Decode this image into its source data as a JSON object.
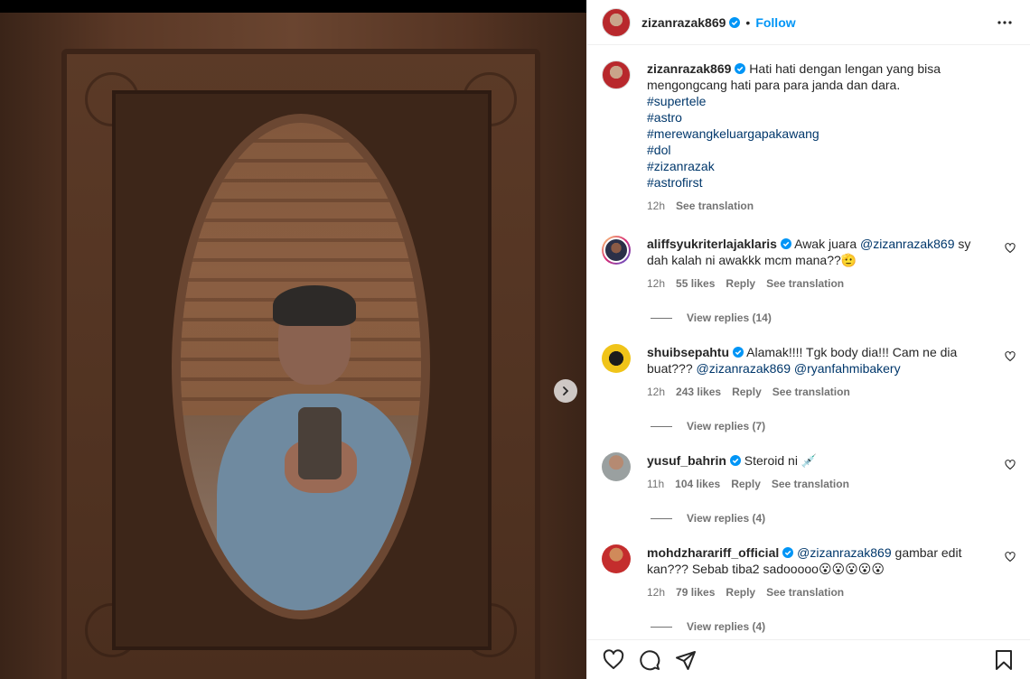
{
  "post": {
    "username": "zizanrazak869",
    "follow_label": "Follow",
    "separator": "•"
  },
  "caption": {
    "username": "zizanrazak869",
    "text": "Hati hati dengan lengan yang bisa mengongcang hati para para janda dan dara.",
    "hashtags": [
      "#supertele",
      "#astro",
      "#merewangkeluargapakawang",
      "#dol",
      "#zizanrazak",
      "#astrofirst"
    ],
    "time": "12h",
    "see_translation": "See translation"
  },
  "comments": [
    {
      "username": "aliffsyukriterlajaklaris",
      "text_before": "Awak juara ",
      "mention": "@zizanrazak869",
      "text_after": " sy dah kalah ni awakkk mcm mana??🫡",
      "time": "12h",
      "likes": "55 likes",
      "reply": "Reply",
      "see_translation": "See translation",
      "view_replies": "View replies (14)"
    },
    {
      "username": "shuibsepahtu",
      "text_before": "Alamak!!!! Tgk body dia!!! Cam ne dia buat??? ",
      "mention": "@zizanrazak869",
      "mention2": "@ryanfahmibakery",
      "time": "12h",
      "likes": "243 likes",
      "reply": "Reply",
      "see_translation": "See translation",
      "view_replies": "View replies (7)"
    },
    {
      "username": "yusuf_bahrin",
      "text_before": "Steroid ni 💉",
      "time": "11h",
      "likes": "104 likes",
      "reply": "Reply",
      "see_translation": "See translation",
      "view_replies": "View replies (4)"
    },
    {
      "username": "mohdzharariff_official",
      "mention": "@zizanrazak869",
      "text_after": " gambar edit kan??? Sebab tiba2 sadooooo😮😮😮😮😮",
      "time": "12h",
      "likes": "79 likes",
      "reply": "Reply",
      "see_translation": "See translation",
      "view_replies": "View replies (4)"
    }
  ],
  "colors": {
    "link": "#00376b",
    "follow": "#0095f6",
    "verified": "#0095f6",
    "muted": "#737373"
  },
  "icons": [
    "more-icon",
    "verified-icon",
    "heart-icon",
    "comment-icon",
    "share-icon",
    "bookmark-icon",
    "chevron-right-icon"
  ]
}
